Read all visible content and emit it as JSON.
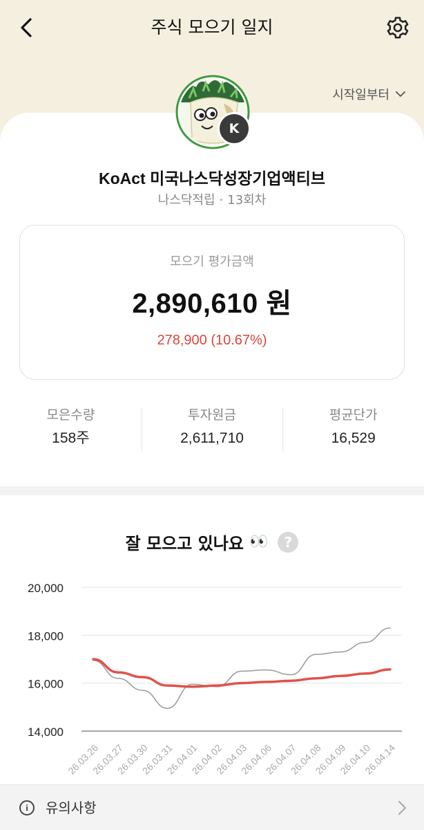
{
  "header": {
    "title": "주식 모으기 일지",
    "back_icon": "chevron-left-icon",
    "settings_icon": "gear-icon"
  },
  "filter": {
    "label": "시작일부터",
    "icon": "chevron-down-icon"
  },
  "profile": {
    "badge": "K"
  },
  "fund": {
    "name": "KoAct 미국나스닥성장기업액티브",
    "category": "나스닥적립",
    "separator": "·",
    "round": "13회차"
  },
  "valuation": {
    "label": "모으기 평가금액",
    "amount": "2,890,610 원",
    "change": "278,900 (10.67%)",
    "change_color": "#d9463c"
  },
  "stats": [
    {
      "label": "모은수량",
      "value": "158주"
    },
    {
      "label": "투자원금",
      "value": "2,611,710"
    },
    {
      "label": "평균단가",
      "value": "16,529"
    }
  ],
  "chart_section": {
    "title": "잘 모으고 있나요",
    "emoji": "👀",
    "help_icon": "question-icon",
    "help_text": "?"
  },
  "chart_data": {
    "type": "line",
    "categories": [
      "26.03.26",
      "26.03.27",
      "26.03.30",
      "26.03.31",
      "26.04.01",
      "26.04.02",
      "26.04.03",
      "26.04.06",
      "26.04.07",
      "26.04.08",
      "26.04.09",
      "26.04.10",
      "26.04.14"
    ],
    "y_ticks": [
      "20,000",
      "18,000",
      "16,000",
      "14,000"
    ],
    "ylim": [
      14000,
      20000
    ],
    "grid": true,
    "series": [
      {
        "color": "#999999",
        "values": [
          16950,
          16200,
          15700,
          14950,
          15950,
          15850,
          16500,
          16550,
          16350,
          17200,
          17300,
          17700,
          18300
        ]
      },
      {
        "color": "#e0524a",
        "values": [
          17000,
          16450,
          16250,
          15900,
          15850,
          15900,
          16000,
          16050,
          16100,
          16200,
          16300,
          16400,
          16570
        ]
      }
    ]
  },
  "notice": {
    "icon": "info-icon",
    "icon_glyph": "i",
    "label": "유의사항",
    "chevron_icon": "chevron-right-icon"
  }
}
